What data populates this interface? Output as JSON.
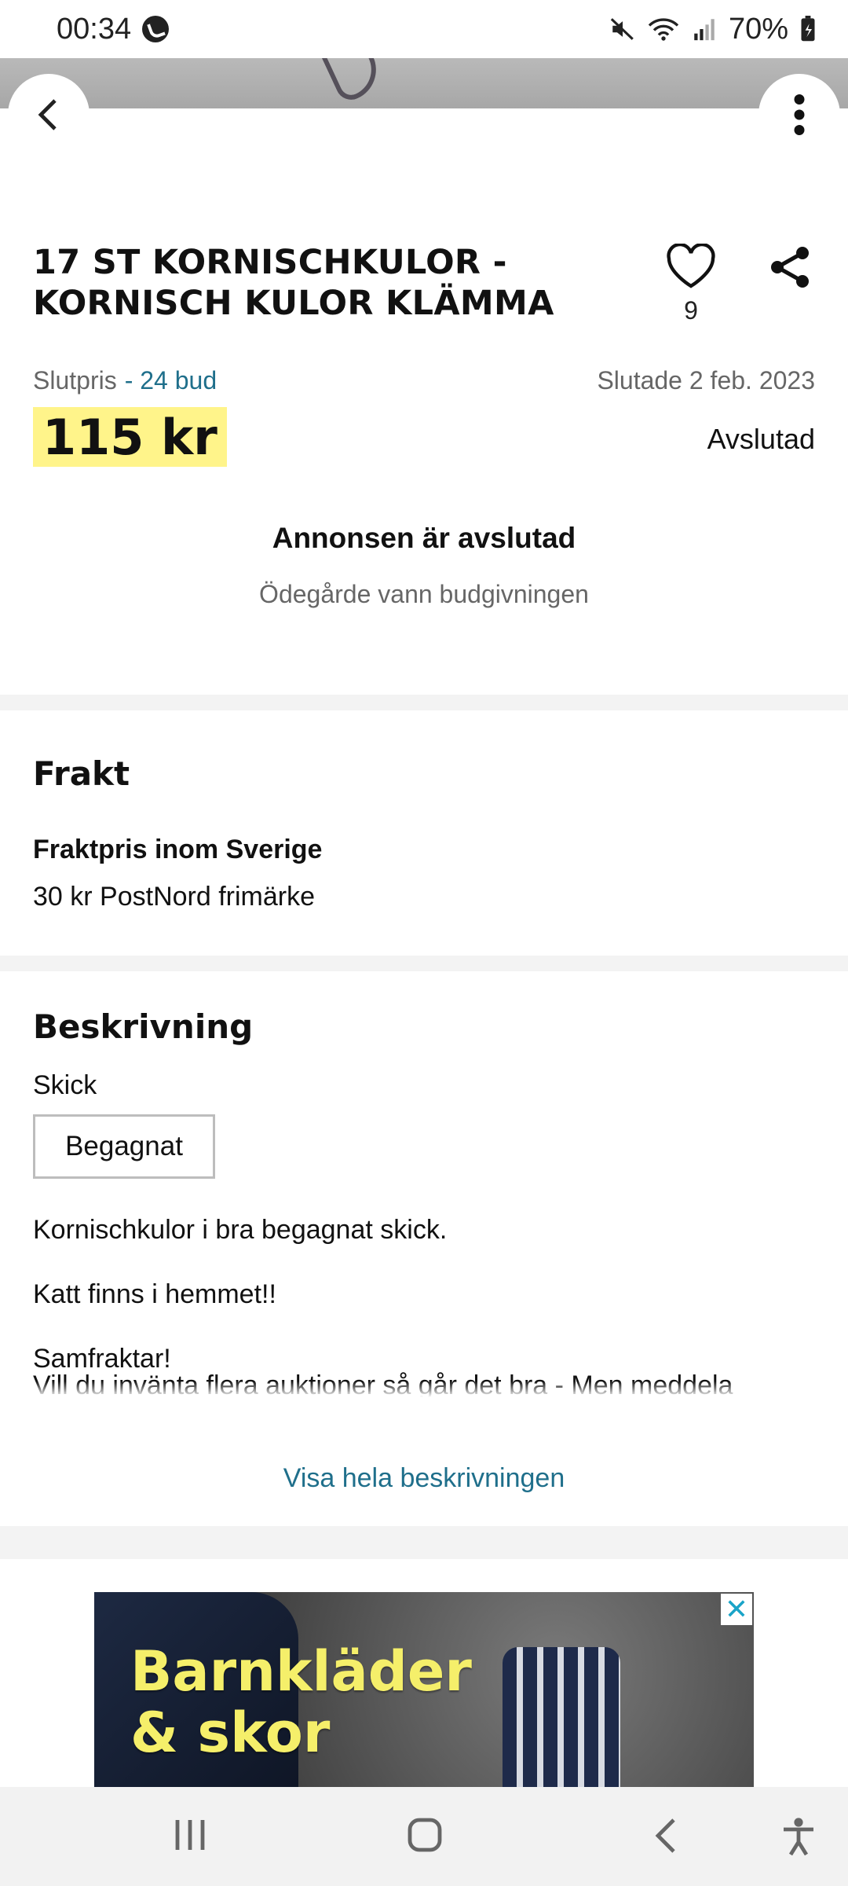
{
  "status_bar": {
    "time": "00:34",
    "battery": "70%",
    "icons": [
      "call-icon",
      "mute-icon",
      "wifi-icon",
      "signal-icon",
      "battery-icon"
    ]
  },
  "listing": {
    "title_line1": "17 ST KORNISCHKULOR -",
    "title_line2": "KORNISCH KULOR KLÄMMA",
    "favorites": "9",
    "price_label": "Slutpris",
    "bid_count": "- 24 bud",
    "ended_date": "Slutade 2 feb. 2023",
    "price": "115 kr",
    "status": "Avslutad",
    "ended_title": "Annonsen är avslutad",
    "ended_subtitle": "Ödegårde vann budgivningen"
  },
  "shipping": {
    "heading": "Frakt",
    "label": "Fraktpris inom Sverige",
    "value": "30 kr PostNord frimärke"
  },
  "description": {
    "heading": "Beskrivning",
    "condition_label": "Skick",
    "condition_value": "Begagnat",
    "line1": "Kornischkulor i bra begagnat skick.",
    "line2": "Katt finns i hemmet!!",
    "line3": "Samfraktar!",
    "line4": "Vill du invänta flera auktioner så går det bra - Men meddela",
    "show_more": "Visa hela beskrivningen"
  },
  "ad": {
    "line1": "Barnkläder",
    "line2": "& skor",
    "close": "✕"
  },
  "colors": {
    "accent_link": "#1f6f8b",
    "price_highlight": "#fff48a",
    "ad_text": "#f5ef6a"
  }
}
